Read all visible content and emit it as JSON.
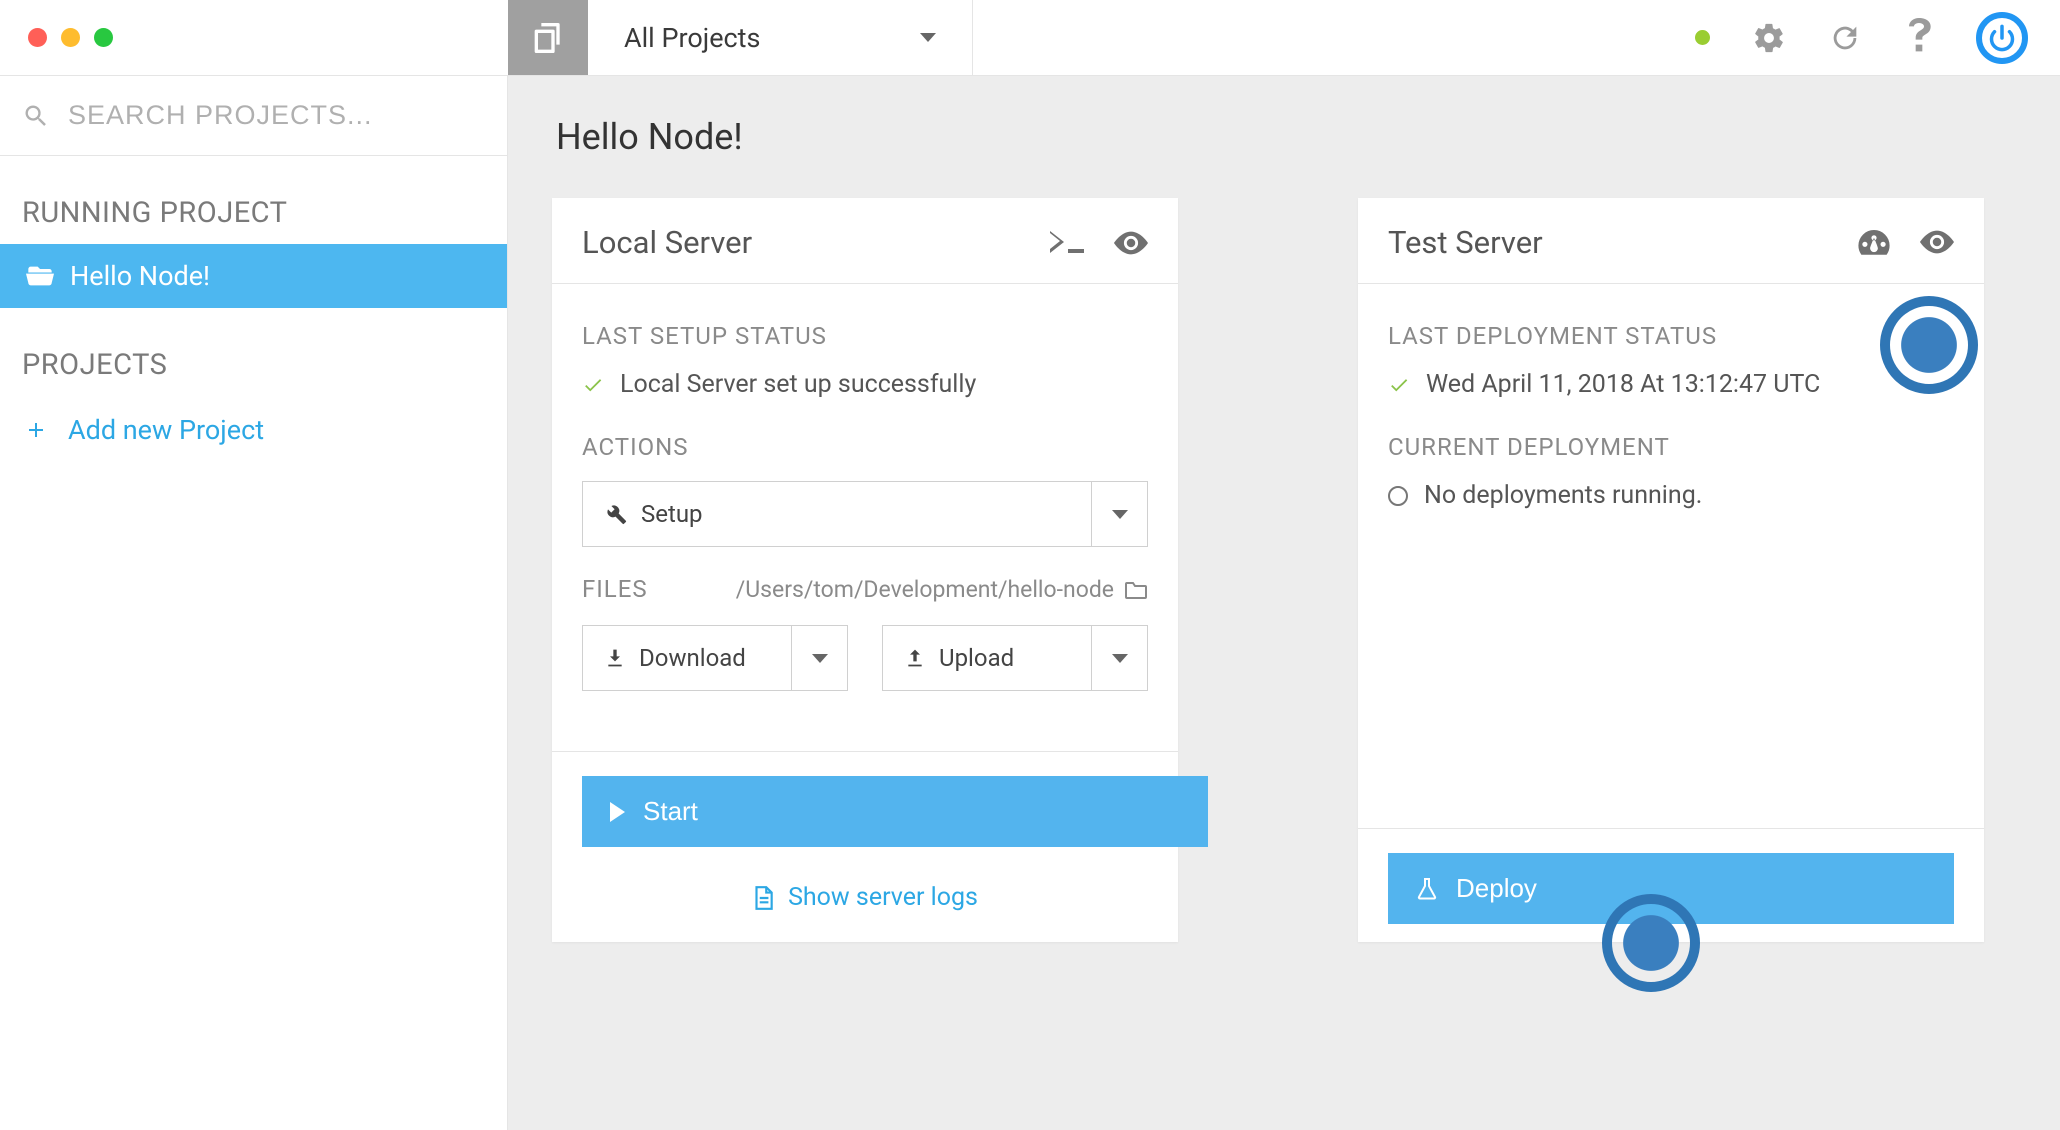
{
  "topbar": {
    "project_filter": "All Projects"
  },
  "sidebar": {
    "search_placeholder": "SEARCH PROJECTS...",
    "running_label": "RUNNING PROJECT",
    "active_project": "Hello Node!",
    "projects_label": "PROJECTS",
    "add_project_label": "Add new Project"
  },
  "page": {
    "title": "Hello Node!"
  },
  "local": {
    "title": "Local Server",
    "last_setup_label": "LAST SETUP STATUS",
    "last_setup_status": "Local Server set up successfully",
    "actions_label": "ACTIONS",
    "setup_btn": "Setup",
    "files_label": "FILES",
    "files_path": "/Users/tom/Development/hello-node",
    "download_btn": "Download",
    "upload_btn": "Upload",
    "start_btn": "Start",
    "server_logs": "Show server logs"
  },
  "test": {
    "title": "Test Server",
    "last_deploy_label": "LAST DEPLOYMENT STATUS",
    "last_deploy_status": "Wed April 11, 2018 At 13:12:47 UTC",
    "current_deploy_label": "CURRENT DEPLOYMENT",
    "current_deploy_status": "No deployments running.",
    "deploy_btn": "Deploy"
  }
}
